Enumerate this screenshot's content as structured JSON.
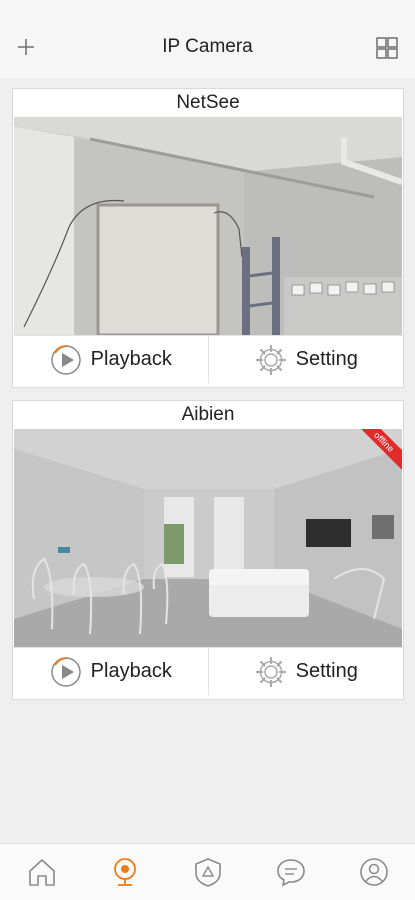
{
  "header": {
    "title": "IP Camera"
  },
  "cameras": [
    {
      "name": "NetSee",
      "playback_label": "Playback",
      "setting_label": "Setting",
      "status": ""
    },
    {
      "name": "Aibien",
      "playback_label": "Playback",
      "setting_label": "Setting",
      "status": "offline"
    }
  ],
  "bottom_nav": {
    "items": [
      {
        "icon": "home-icon"
      },
      {
        "icon": "camera-icon",
        "active": true
      },
      {
        "icon": "shield-icon"
      },
      {
        "icon": "chat-icon"
      },
      {
        "icon": "profile-icon"
      }
    ]
  },
  "colors": {
    "accent": "#f07a1a",
    "offline": "#e02b2b",
    "icon_gray": "#8a8a8a"
  }
}
